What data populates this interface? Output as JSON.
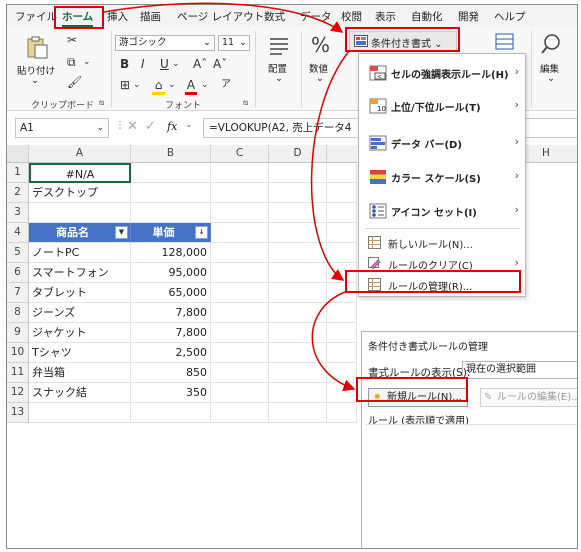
{
  "tabs": [
    "ファイル",
    "ホーム",
    "挿入",
    "描画",
    "ページ レイアウト",
    "数式",
    "データ",
    "校閲",
    "表示",
    "自動化",
    "開発",
    "ヘルプ"
  ],
  "ribbon": {
    "paste_label": "貼り付け",
    "clipboard_label": "クリップボード",
    "font_name": "游ゴシック",
    "font_size": "11",
    "font_label": "フォント",
    "align_label": "配置",
    "number_label": "数値",
    "edit_label": "編集",
    "conditional_format_label": "条件付き書式 ⌄"
  },
  "formula_bar": {
    "name_box": "A1",
    "fx": "fx",
    "formula": "=VLOOKUP(A2, 売上データ4"
  },
  "columns": [
    "A",
    "B",
    "C",
    "D",
    "H"
  ],
  "rows": [
    "1",
    "2",
    "3",
    "4",
    "5",
    "6",
    "7",
    "8",
    "9",
    "10",
    "11",
    "12",
    "13"
  ],
  "cells": {
    "a1": "#N/A",
    "a2": "デスクトップ",
    "header_name": "商品名",
    "header_price": "単価",
    "items": [
      {
        "name": "ノートPC",
        "price": "128,000"
      },
      {
        "name": "スマートフォン",
        "price": "95,000"
      },
      {
        "name": "タブレット",
        "price": "65,000"
      },
      {
        "name": "ジーンズ",
        "price": "7,800"
      },
      {
        "name": "ジャケット",
        "price": "7,800"
      },
      {
        "name": "Tシャツ",
        "price": "2,500"
      },
      {
        "name": "弁当箱",
        "price": "850"
      },
      {
        "name": "スナック結",
        "price": "350"
      }
    ]
  },
  "menu": {
    "items": [
      {
        "label": "セルの強調表示ルール(H)"
      },
      {
        "label": "上位/下位ルール(T)"
      },
      {
        "label": "データ バー(D)"
      },
      {
        "label": "カラー スケール(S)"
      },
      {
        "label": "アイコン セット(I)"
      }
    ],
    "new_rule": "新しいルール(N)...",
    "clear_rules": "ルールのクリア(C)",
    "manage_rules": "ルールの管理(R)..."
  },
  "dialog": {
    "title": "条件付き書式ルールの管理",
    "show_rules_label": "書式ルールの表示(S):",
    "scope_value": "現在の選択範囲",
    "new_rule_button": "新規ルール(N)...",
    "edit_rule_button": "ルールの編集(E)...",
    "rules_header": "ルール (表示順で適用)"
  },
  "colors": {
    "highlight": "#e00000",
    "table_header": "#4472c4",
    "accent": "#1a6b3b"
  }
}
